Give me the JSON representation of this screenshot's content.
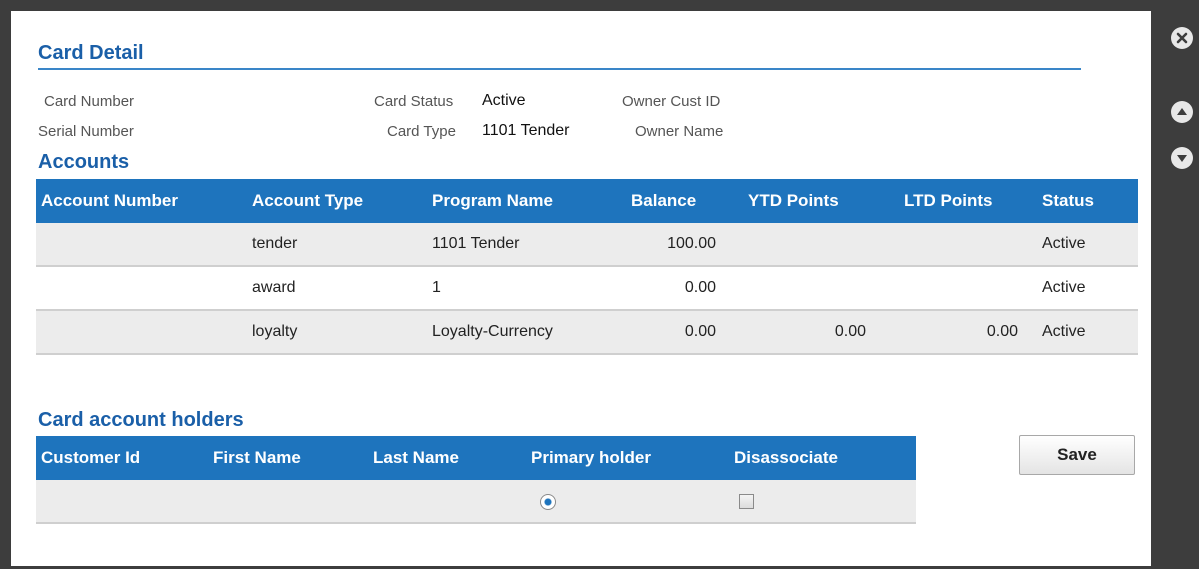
{
  "card_detail": {
    "title": "Card Detail",
    "card_number_label": "Card Number",
    "serial_number_label": "Serial Number",
    "card_status_label": "Card Status",
    "card_status_value": "Active",
    "card_type_label": "Card Type",
    "card_type_value": "1101 Tender",
    "owner_cust_id_label": "Owner Cust ID",
    "owner_name_label": "Owner Name"
  },
  "accounts": {
    "title": "Accounts",
    "columns": [
      "Account Number",
      "Account Type",
      "Program Name",
      "Balance",
      "YTD Points",
      "LTD Points",
      "Status"
    ],
    "rows": [
      {
        "account_number": "",
        "account_type": "tender",
        "program_name": "1101 Tender",
        "balance": "100.00",
        "ytd_points": "",
        "ltd_points": "",
        "status": "Active"
      },
      {
        "account_number": "",
        "account_type": "award",
        "program_name": "1",
        "balance": "0.00",
        "ytd_points": "",
        "ltd_points": "",
        "status": "Active"
      },
      {
        "account_number": "",
        "account_type": "loyalty",
        "program_name": "Loyalty-Currency",
        "balance": "0.00",
        "ytd_points": "0.00",
        "ltd_points": "0.00",
        "status": "Active"
      }
    ]
  },
  "holders": {
    "title": "Card account holders",
    "columns": [
      "Customer Id",
      "First Name",
      "Last Name",
      "Primary holder",
      "Disassociate"
    ],
    "rows": [
      {
        "customer_id": "",
        "first_name": "",
        "last_name": "",
        "primary_holder": true,
        "disassociate": false
      }
    ]
  },
  "actions": {
    "save_label": "Save"
  },
  "icons": {
    "close": "close-icon",
    "scroll_up": "arrow-up-icon",
    "scroll_down": "arrow-down-icon"
  },
  "colors": {
    "accent": "#1e74bd",
    "heading": "#1a5fa8",
    "overlay": "#3d3d3d"
  }
}
